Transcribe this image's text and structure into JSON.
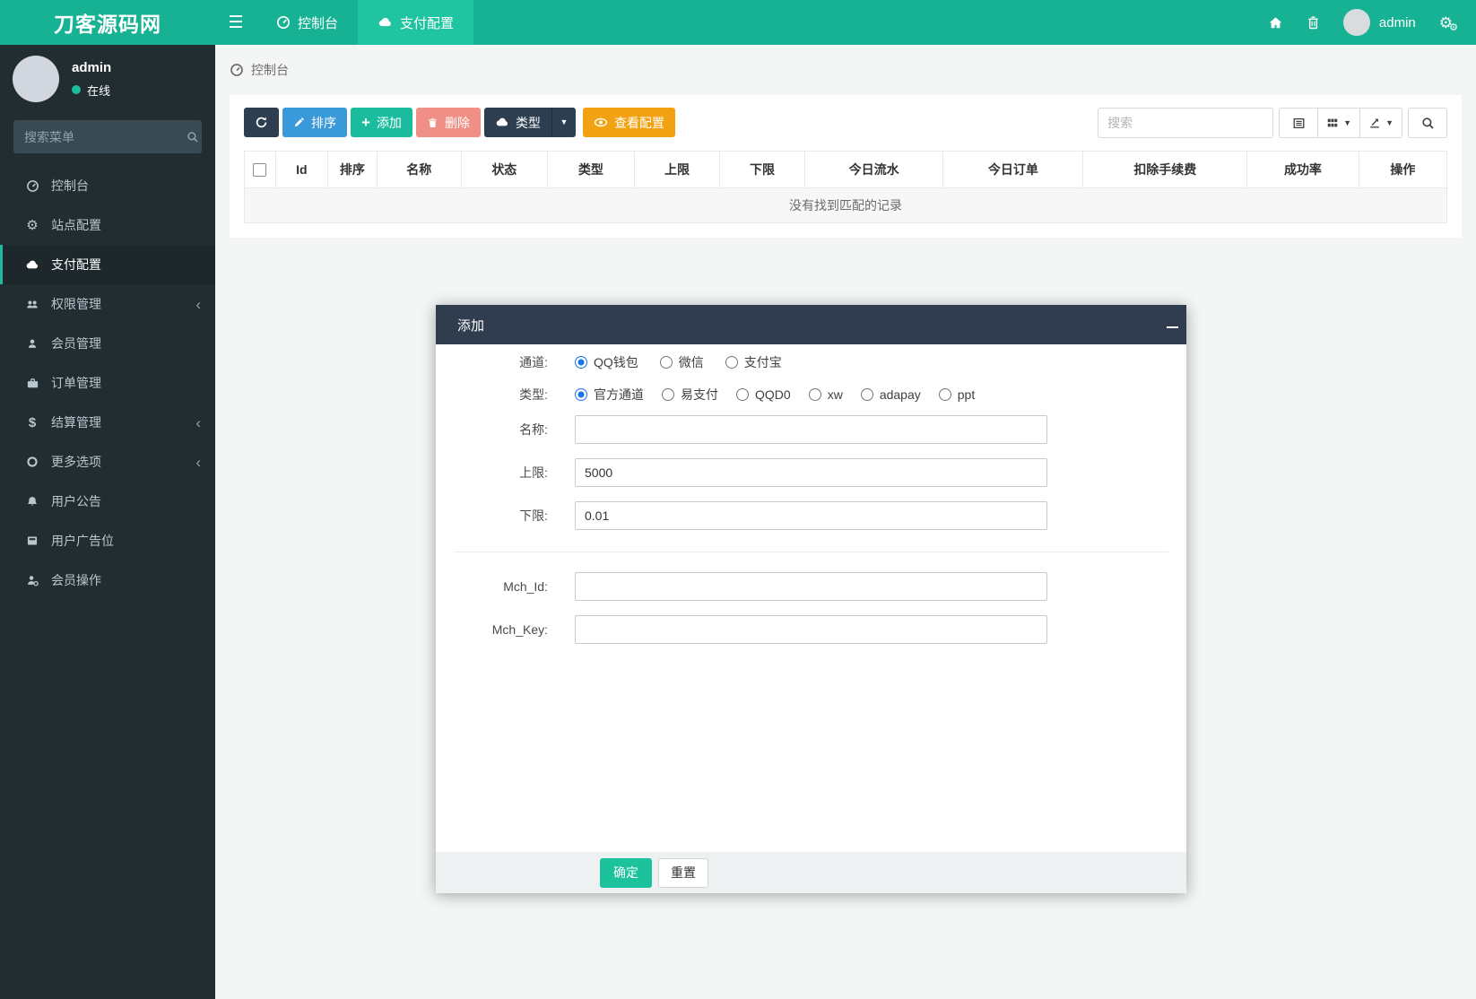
{
  "colors": {
    "navbar_teal": "#17b294",
    "navbar_active_tab": "#1fc4a1",
    "sidebar_bg": "#222d32",
    "sidebar_active_accent": "#1abc9c",
    "button_dark": "#2c3e50",
    "button_blue": "#3a99d9",
    "button_green": "#1bbc9d",
    "button_red": "#e74c3c",
    "button_orange": "#f2a111",
    "modal_header": "#2f3d4f",
    "radio_checked": "#1a73e8",
    "online_dot": "#1abc9c"
  },
  "navbar": {
    "brand": "刀客源码网",
    "tabs": [
      {
        "label": "控制台"
      },
      {
        "label": "支付配置"
      }
    ],
    "username": "admin"
  },
  "sidebar": {
    "user_name": "admin",
    "user_status": "在线",
    "search_placeholder": "搜索菜单",
    "items": [
      {
        "label": "控制台"
      },
      {
        "label": "站点配置"
      },
      {
        "label": "支付配置"
      },
      {
        "label": "权限管理"
      },
      {
        "label": "会员管理"
      },
      {
        "label": "订单管理"
      },
      {
        "label": "结算管理"
      },
      {
        "label": "更多选项"
      },
      {
        "label": "用户公告"
      },
      {
        "label": "用户广告位"
      },
      {
        "label": "会员操作"
      }
    ]
  },
  "breadcrumb": {
    "label": "控制台"
  },
  "toolbar": {
    "sort": "排序",
    "add": "添加",
    "delete": "删除",
    "type": "类型",
    "view_config": "查看配置",
    "search_placeholder": "搜索"
  },
  "table": {
    "columns": [
      "Id",
      "排序",
      "名称",
      "状态",
      "类型",
      "上限",
      "下限",
      "今日流水",
      "今日订单",
      "扣除手续费",
      "成功率",
      "操作"
    ],
    "empty_text": "没有找到匹配的记录"
  },
  "modal": {
    "title": "添加",
    "channel": {
      "label": "通道:",
      "options": [
        "QQ钱包",
        "微信",
        "支付宝"
      ],
      "selected": "QQ钱包"
    },
    "type": {
      "label": "类型:",
      "options": [
        "官方通道",
        "易支付",
        "QQD0",
        "xw",
        "adapay",
        "ppt"
      ],
      "selected": "官方通道"
    },
    "name": {
      "label": "名称:",
      "value": ""
    },
    "upper_limit": {
      "label": "上限:",
      "value": "5000"
    },
    "lower_limit": {
      "label": "下限:",
      "value": "0.01"
    },
    "mch_id": {
      "label": "Mch_Id:",
      "value": ""
    },
    "mch_key": {
      "label": "Mch_Key:",
      "value": ""
    },
    "confirm": "确定",
    "reset": "重置"
  }
}
